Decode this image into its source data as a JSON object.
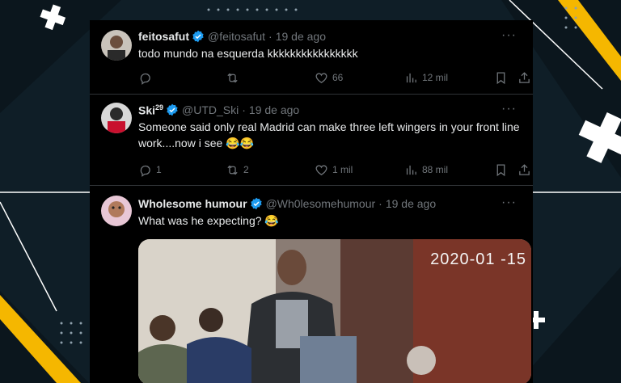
{
  "colors": {
    "verified": "#1d9bf0",
    "accent_yellow": "#f5b700",
    "background": "#0f1e27"
  },
  "tweets": [
    {
      "name": "feitosafut",
      "superscript": "",
      "handle": "@feitosafut",
      "time": "19 de ago",
      "text": "todo mundo na esquerda kkkkkkkkkkkkkkkk",
      "replies": "",
      "retweets": "",
      "likes": "66",
      "views": "12 mil"
    },
    {
      "name": "Ski",
      "superscript": "29",
      "handle": "@UTD_Ski",
      "time": "19 de ago",
      "text": "Someone said only real Madrid can make three left wingers in your front line work....now i see 😂😂",
      "replies": "1",
      "retweets": "2",
      "likes": "1 mil",
      "views": "88 mil"
    },
    {
      "name": "Wholesome humour",
      "superscript": "",
      "handle": "@Wh0lesomehumour",
      "time": "19 de ago",
      "text": "What was he expecting? 😂",
      "media_timestamp": "2020-01 -15"
    }
  ],
  "icons": [
    "reply-icon",
    "retweet-icon",
    "like-icon",
    "views-icon",
    "bookmark-icon",
    "share-icon",
    "verified-icon",
    "more-icon"
  ]
}
